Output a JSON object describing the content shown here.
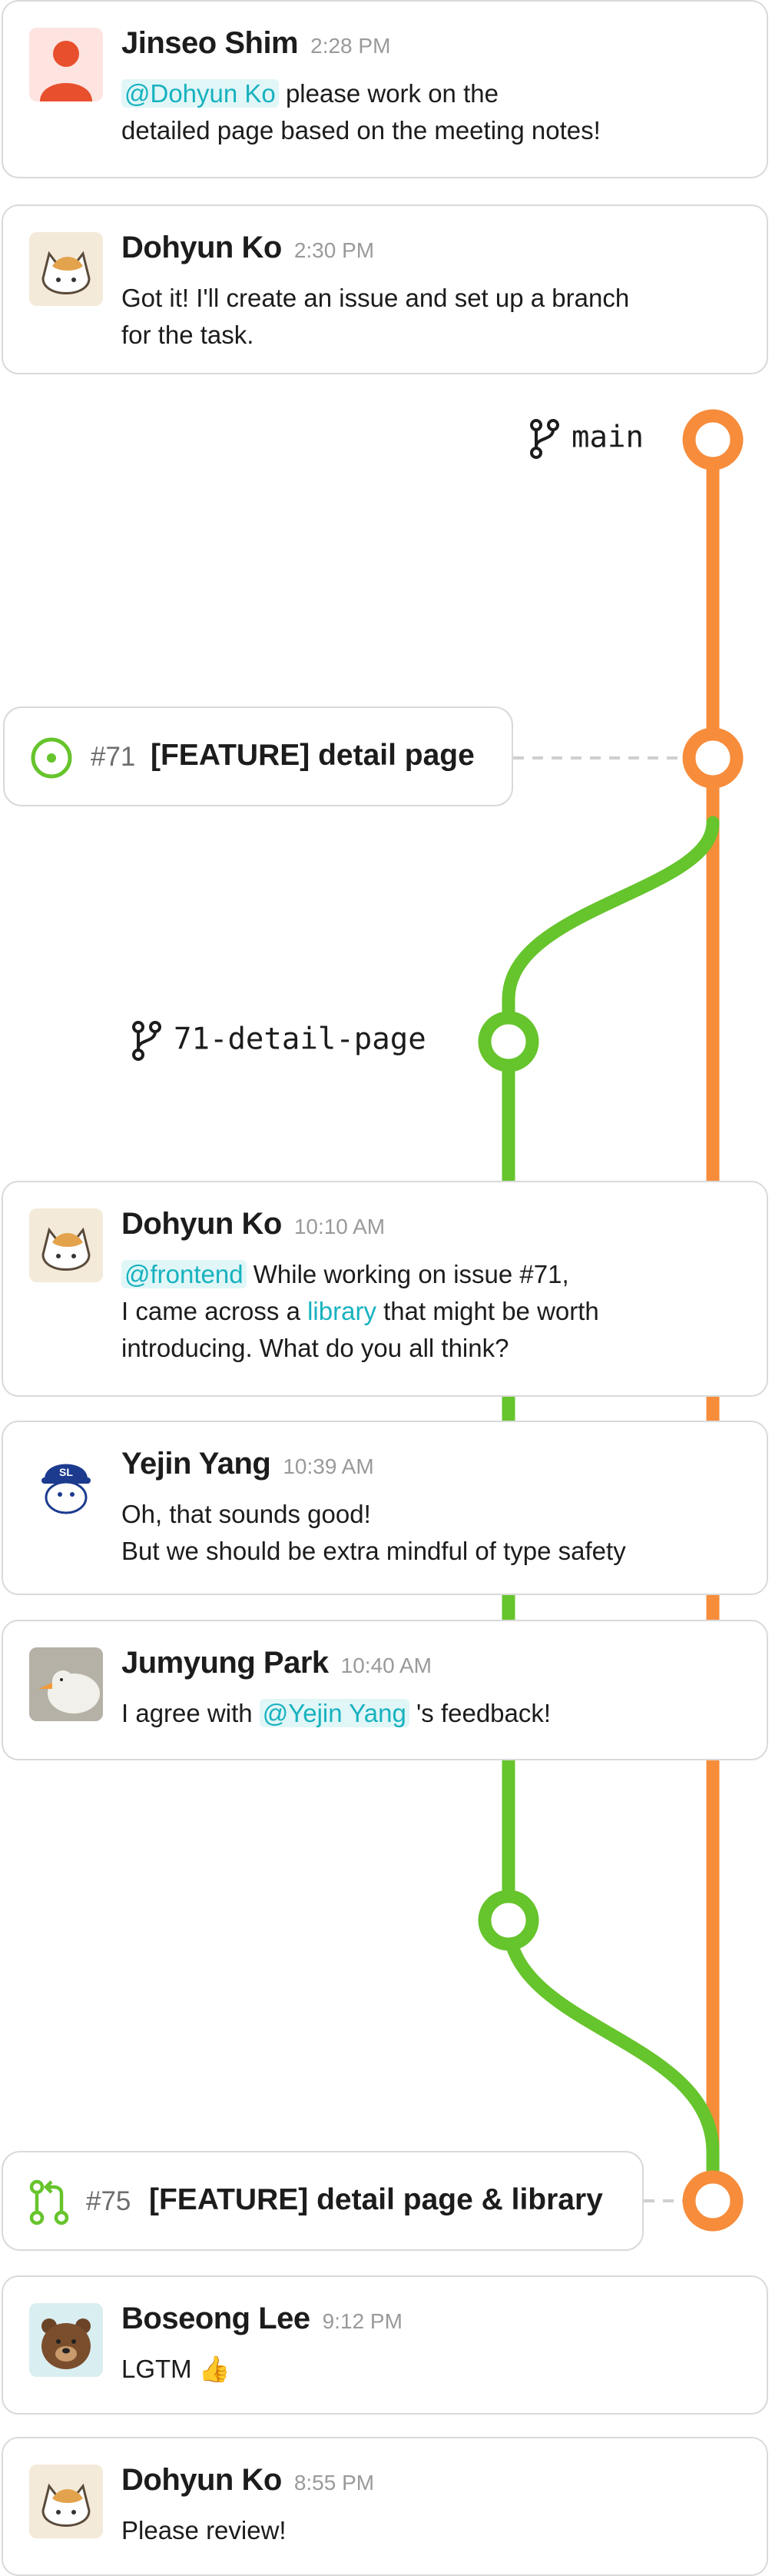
{
  "colors": {
    "main_branch": "#f78c3b",
    "feature_branch": "#66c42c",
    "mention_bg": "#e1f6f7",
    "mention_text": "#17b2bf"
  },
  "messages": [
    {
      "author": "Jinseo Shim",
      "time": "2:28 PM",
      "avatar": "person-icon",
      "mention": "@Dohyun Ko",
      "line1_after": " please work on the",
      "line2": "detailed page based on the meeting notes!"
    },
    {
      "author": "Dohyun Ko",
      "time": "2:30 PM",
      "avatar": "cat-avatar",
      "line1": "Got it! I'll create an issue and set up a branch",
      "line2": "for the task."
    },
    {
      "author": "Dohyun Ko",
      "time": "10:10 AM",
      "avatar": "cat-avatar",
      "mention": "@frontend",
      "line1_after": " While working on issue #71,",
      "line2_before": "I came across a ",
      "link": "library",
      "line2_after": " that might be worth",
      "line3": "introducing. What do you all think?"
    },
    {
      "author": "Yejin Yang",
      "time": "10:39 AM",
      "avatar": "baseball-mascot-avatar",
      "line1": "Oh, that sounds good!",
      "line2": "But we should be extra mindful of type safety"
    },
    {
      "author": "Jumyung Park",
      "time": "10:40 AM",
      "avatar": "duck-avatar",
      "line1_before": "I agree with ",
      "mention": "@Yejin Yang",
      "line1_after": " 's feedback!"
    },
    {
      "author": "Boseong Lee",
      "time": "9:12 PM",
      "avatar": "bear-avatar",
      "line1": "LGTM 👍"
    },
    {
      "author": "Dohyun Ko",
      "time": "8:55 PM",
      "avatar": "cat-avatar",
      "line1": "Please review!"
    }
  ],
  "branches": {
    "main": "main",
    "feature": "71-detail-page"
  },
  "issue": {
    "number": "#71",
    "title": "[FEATURE] detail page",
    "icon": "issue-open-icon"
  },
  "pull_request": {
    "number": "#75",
    "title": "[FEATURE] detail page & library",
    "icon": "pull-request-icon"
  }
}
